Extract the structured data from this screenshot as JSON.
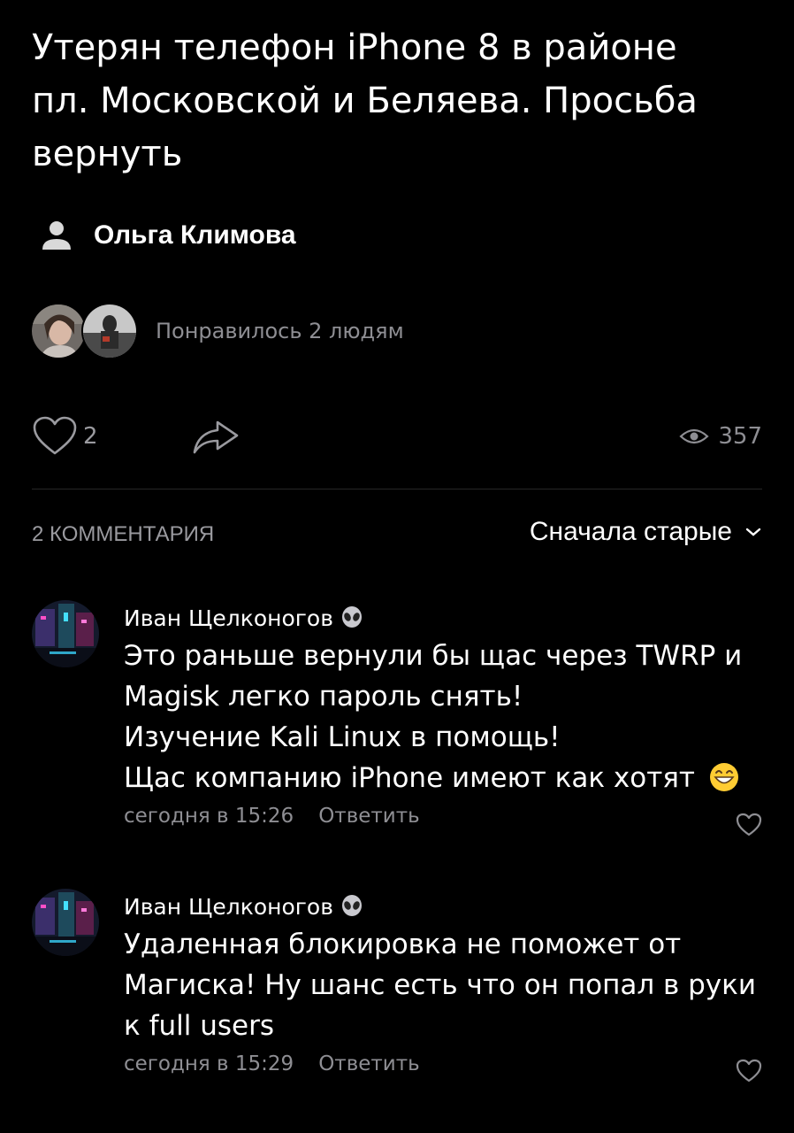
{
  "post": {
    "title_lines": [
      "Утерян телефон iPhone 8 в районе",
      "пл. Московской и Беляева. Просьба",
      "вернуть"
    ],
    "author": "Ольга Климова",
    "author_icon": "user-icon",
    "likers_text": "Понравилось 2 людям",
    "like_count": "2",
    "views_count": "357"
  },
  "comments_section": {
    "count_label": "2 КОММЕНТАРИЯ",
    "sort_label": "Сначала старые"
  },
  "comments": [
    {
      "author": "Иван Щелконогов",
      "badge_icon": "alien-emoji-icon",
      "lines": [
        "Это раньше вернули бы щас через TWRP и",
        "Magisk легко пароль снять!",
        "Изучение Kali Linux в помощь!",
        "Щас компанию iPhone имеют как хотят"
      ],
      "emoji": "grinning-emoji-icon",
      "time": "сегодня в 15:26",
      "reply_label": "Ответить"
    },
    {
      "author": "Иван Щелконогов",
      "badge_icon": "alien-emoji-icon",
      "lines": [
        "Удаленная блокировка не поможет от",
        "Магиска! Ну шанс есть что он попал в руки",
        "к full users"
      ],
      "time": "сегодня в 15:29",
      "reply_label": "Ответить"
    }
  ],
  "colors": {
    "background": "#000000",
    "text": "#ffffff",
    "muted": "#8e8e93",
    "divider": "#262626"
  }
}
